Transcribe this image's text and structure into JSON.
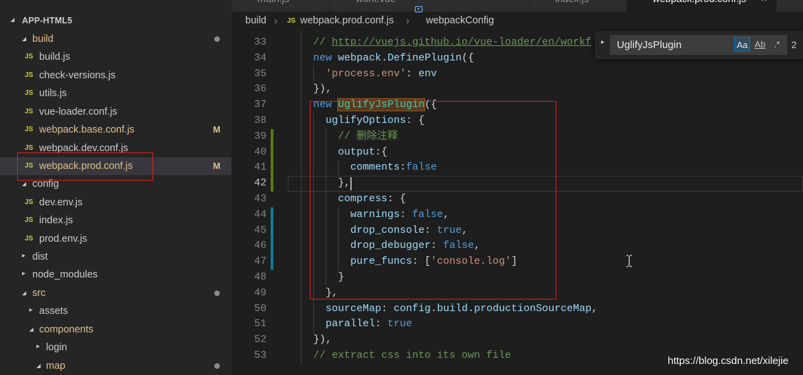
{
  "tabs": [
    {
      "label": "main.js"
    },
    {
      "label": "work.vue"
    },
    {
      "label": ""
    },
    {
      "label": "index.js"
    },
    {
      "label": "webpack.prod.conf.js",
      "close": "×",
      "active": true
    }
  ],
  "breadcrumb": {
    "folder": "build",
    "separator": "›",
    "file_icon": "JS",
    "file": "webpack.prod.conf.js",
    "symbol": "webpackConfig"
  },
  "explorer": {
    "title": "APP-HTML5",
    "js_icon": "JS",
    "items": [
      {
        "label": "build",
        "kind": "folder",
        "depth": 1,
        "open": true,
        "modified": true,
        "badge_icon": "dot"
      },
      {
        "label": "build.js",
        "kind": "file",
        "depth": 2
      },
      {
        "label": "check-versions.js",
        "kind": "file",
        "depth": 2
      },
      {
        "label": "utils.js",
        "kind": "file",
        "depth": 2
      },
      {
        "label": "vue-loader.conf.js",
        "kind": "file",
        "depth": 2
      },
      {
        "label": "webpack.base.conf.js",
        "kind": "file",
        "depth": 2,
        "modified": true,
        "badge": "M"
      },
      {
        "label": "webpack.dev.conf.js",
        "kind": "file",
        "depth": 2
      },
      {
        "label": "webpack.prod.conf.js",
        "kind": "file",
        "depth": 2,
        "modified": true,
        "badge": "M",
        "selected": true
      },
      {
        "label": "config",
        "kind": "folder",
        "depth": 1,
        "open": true
      },
      {
        "label": "dev.env.js",
        "kind": "file",
        "depth": 2
      },
      {
        "label": "index.js",
        "kind": "file",
        "depth": 2
      },
      {
        "label": "prod.env.js",
        "kind": "file",
        "depth": 2
      },
      {
        "label": "dist",
        "kind": "folder",
        "depth": 1,
        "open": false
      },
      {
        "label": "node_modules",
        "kind": "folder",
        "depth": 1,
        "open": false
      },
      {
        "label": "src",
        "kind": "folder",
        "depth": 1,
        "open": true,
        "modified": true,
        "badge_icon": "dot"
      },
      {
        "label": "assets",
        "kind": "folder",
        "depth": 2,
        "open": false
      },
      {
        "label": "components",
        "kind": "folder",
        "depth": 2,
        "open": true,
        "modified": true
      },
      {
        "label": "login",
        "kind": "folder",
        "depth": 3,
        "open": false
      },
      {
        "label": "map",
        "kind": "folder",
        "depth": 3,
        "open": true,
        "modified": true,
        "badge_icon": "dot"
      }
    ]
  },
  "editor": {
    "current_line": "42",
    "lines": [
      {
        "num": "33",
        "tokens": [
          [
            "    // ",
            "c"
          ],
          [
            "http://vuejs.github.io/vue-loader/en/workf",
            "u"
          ]
        ]
      },
      {
        "num": "34",
        "tokens": [
          [
            "    ",
            "p"
          ],
          [
            "new",
            "k"
          ],
          [
            " ",
            "p"
          ],
          [
            "webpack",
            "v"
          ],
          [
            ".",
            "p"
          ],
          [
            "DefinePlugin",
            "v"
          ],
          [
            "({",
            "p"
          ]
        ]
      },
      {
        "num": "35",
        "tokens": [
          [
            "      ",
            "p"
          ],
          [
            "'process.env'",
            "s"
          ],
          [
            ": ",
            "p"
          ],
          [
            "env",
            "v"
          ]
        ]
      },
      {
        "num": "36",
        "tokens": [
          [
            "    }),",
            "p"
          ]
        ]
      },
      {
        "num": "37",
        "tokens": [
          [
            "    ",
            "p"
          ],
          [
            "new",
            "k"
          ],
          [
            " ",
            "p"
          ],
          [
            "UglifyJsPlugin",
            "m"
          ],
          [
            "({",
            "p"
          ]
        ]
      },
      {
        "num": "38",
        "tokens": [
          [
            "      ",
            "p"
          ],
          [
            "uglifyOptions",
            "v"
          ],
          [
            ": {",
            "p"
          ]
        ]
      },
      {
        "num": "39",
        "tokens": [
          [
            "        // 删除注释",
            "c"
          ]
        ]
      },
      {
        "num": "40",
        "tokens": [
          [
            "        ",
            "p"
          ],
          [
            "output",
            "v"
          ],
          [
            ":{",
            "p"
          ]
        ]
      },
      {
        "num": "41",
        "tokens": [
          [
            "          ",
            "p"
          ],
          [
            "comments",
            "v"
          ],
          [
            ":",
            "p"
          ],
          [
            "false",
            "k"
          ]
        ]
      },
      {
        "num": "42",
        "tokens": [
          [
            "        },",
            "p"
          ]
        ]
      },
      {
        "num": "43",
        "tokens": [
          [
            "        ",
            "p"
          ],
          [
            "compress",
            "v"
          ],
          [
            ": {",
            "p"
          ]
        ]
      },
      {
        "num": "44",
        "tokens": [
          [
            "          ",
            "p"
          ],
          [
            "warnings",
            "v"
          ],
          [
            ": ",
            "p"
          ],
          [
            "false",
            "k"
          ],
          [
            ",",
            "p"
          ]
        ]
      },
      {
        "num": "45",
        "tokens": [
          [
            "          ",
            "p"
          ],
          [
            "drop_console",
            "v"
          ],
          [
            ": ",
            "p"
          ],
          [
            "true",
            "k"
          ],
          [
            ",",
            "p"
          ]
        ]
      },
      {
        "num": "46",
        "tokens": [
          [
            "          ",
            "p"
          ],
          [
            "drop_debugger",
            "v"
          ],
          [
            ": ",
            "p"
          ],
          [
            "false",
            "k"
          ],
          [
            ",",
            "p"
          ]
        ]
      },
      {
        "num": "47",
        "tokens": [
          [
            "          ",
            "p"
          ],
          [
            "pure_funcs",
            "v"
          ],
          [
            ": [",
            "p"
          ],
          [
            "'console.log'",
            "s"
          ],
          [
            "]",
            "p"
          ]
        ]
      },
      {
        "num": "48",
        "tokens": [
          [
            "        }",
            "p"
          ]
        ]
      },
      {
        "num": "49",
        "tokens": [
          [
            "      },",
            "p"
          ]
        ]
      },
      {
        "num": "50",
        "tokens": [
          [
            "      ",
            "p"
          ],
          [
            "sourceMap",
            "v"
          ],
          [
            ": ",
            "p"
          ],
          [
            "config",
            "v"
          ],
          [
            ".",
            "p"
          ],
          [
            "build",
            "v"
          ],
          [
            ".",
            "p"
          ],
          [
            "productionSourceMap",
            "v"
          ],
          [
            ",",
            "p"
          ]
        ]
      },
      {
        "num": "51",
        "tokens": [
          [
            "      ",
            "p"
          ],
          [
            "parallel",
            "v"
          ],
          [
            ": ",
            "p"
          ],
          [
            "true",
            "k"
          ]
        ]
      },
      {
        "num": "52",
        "tokens": [
          [
            "    }),",
            "p"
          ]
        ]
      },
      {
        "num": "53",
        "tokens": [
          [
            "    // extract css into its own file",
            "c"
          ]
        ]
      }
    ]
  },
  "find_widget": {
    "query": "UglifyJsPlugin",
    "match_case": "Aa",
    "whole_word": "Ab",
    "regex": ".*",
    "result": "2"
  },
  "watermark": "https://blog.csdn.net/xilejie",
  "colors": {
    "editor_bg": "#1e1e1e",
    "sidebar_bg": "#252526",
    "selection_bg": "#37373d",
    "modified": "#e2c08d",
    "keyword": "#569cd6",
    "variable": "#9cdcfe",
    "string": "#ce9178",
    "comment": "#6a9955",
    "annotation_box": "#e0201a",
    "git_added": "#587c0c",
    "git_modified": "#0c7d9d"
  }
}
